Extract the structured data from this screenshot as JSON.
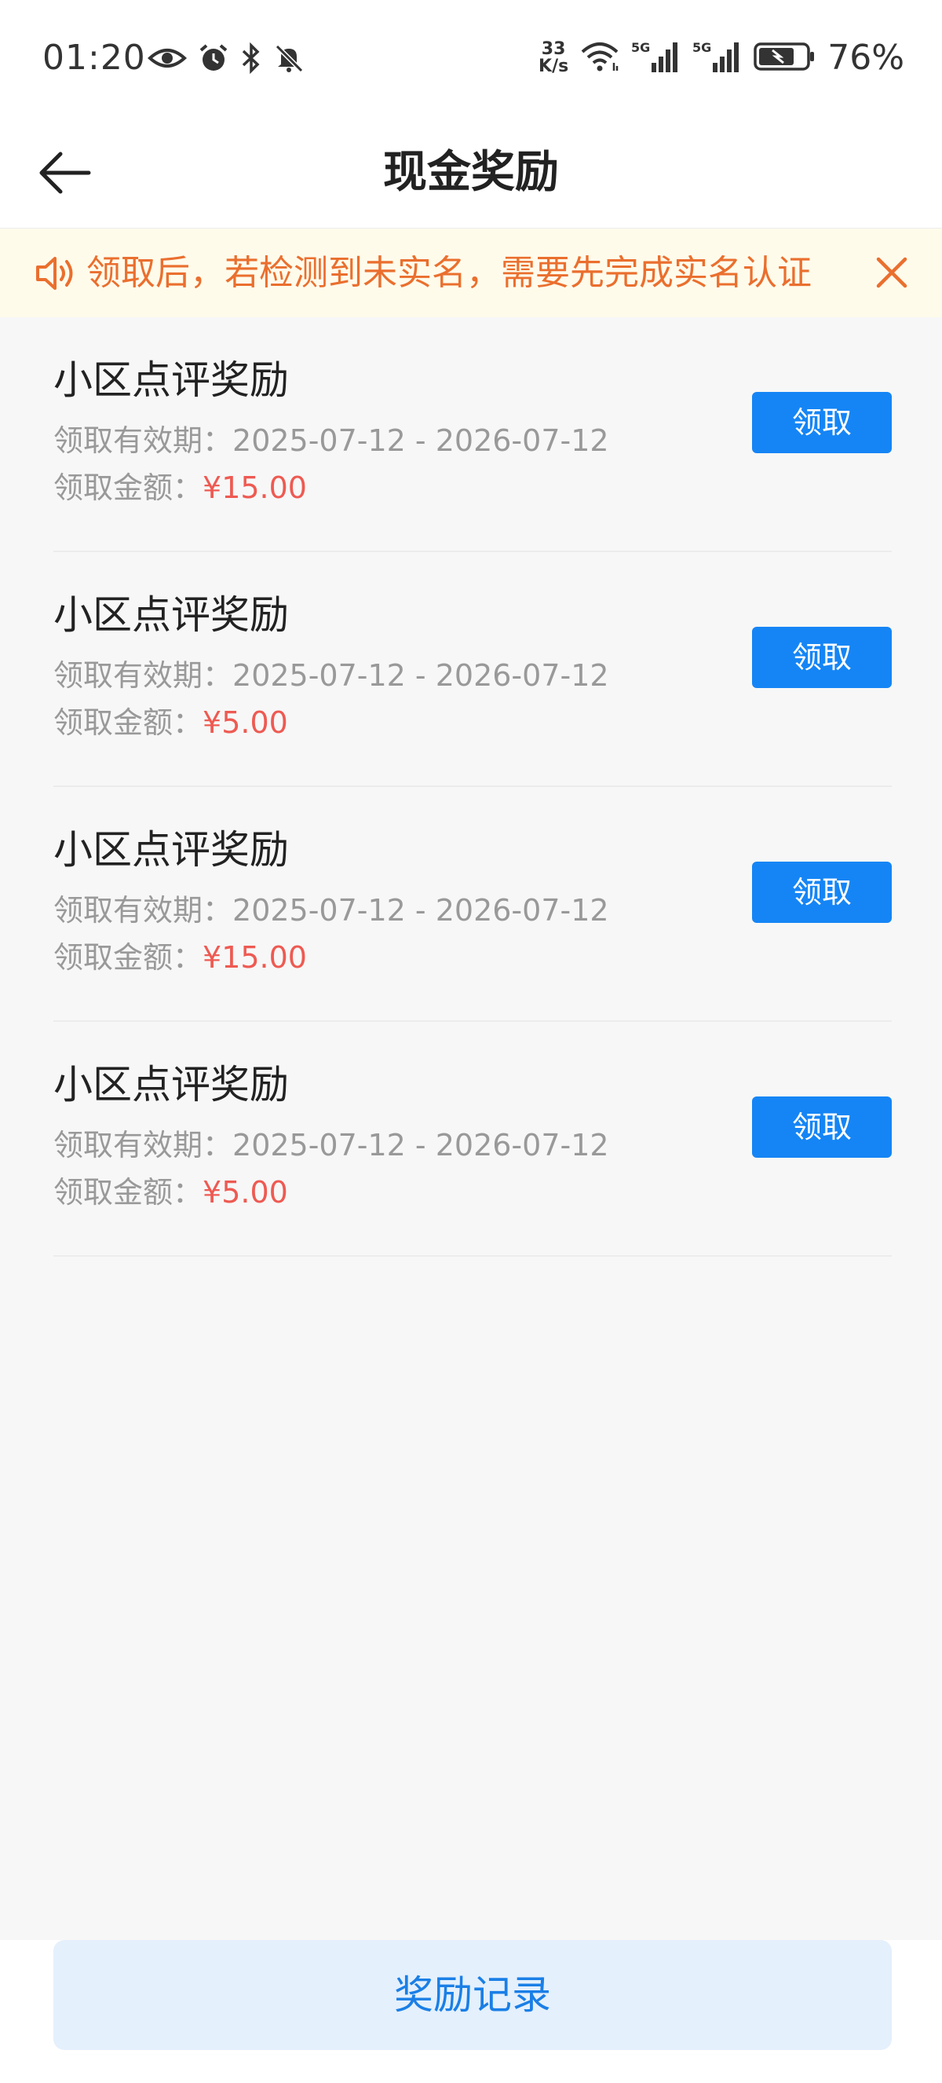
{
  "status_bar": {
    "time": "01:20",
    "net_speed_value": "33",
    "net_speed_unit": "K/s",
    "signal_1_label": "5G",
    "signal_2_label": "5G",
    "battery_percent": "76%"
  },
  "header": {
    "title": "现金奖励"
  },
  "notice": {
    "text": "领取后，若检测到未实名，需要先完成实名认证",
    "text_color": "#ea6f2e",
    "background": "#fffbeb"
  },
  "rewards": [
    {
      "title": "小区点评奖励",
      "validity_label": "领取有效期：",
      "validity_range": "2025-07-12 - 2026-07-12",
      "amount_label": "领取金额：",
      "amount_value": "¥15.00",
      "claim_label": "领取"
    },
    {
      "title": "小区点评奖励",
      "validity_label": "领取有效期：",
      "validity_range": "2025-07-12 - 2026-07-12",
      "amount_label": "领取金额：",
      "amount_value": "¥5.00",
      "claim_label": "领取"
    },
    {
      "title": "小区点评奖励",
      "validity_label": "领取有效期：",
      "validity_range": "2025-07-12 - 2026-07-12",
      "amount_label": "领取金额：",
      "amount_value": "¥15.00",
      "claim_label": "领取"
    },
    {
      "title": "小区点评奖励",
      "validity_label": "领取有效期：",
      "validity_range": "2025-07-12 - 2026-07-12",
      "amount_label": "领取金额：",
      "amount_value": "¥5.00",
      "claim_label": "领取"
    }
  ],
  "footer": {
    "records_label": "奖励记录"
  },
  "colors": {
    "accent_blue": "#1585f5",
    "amount_red": "#ee5a52",
    "records_button_bg": "#e4f0fc",
    "records_button_text": "#1a7fe6"
  }
}
